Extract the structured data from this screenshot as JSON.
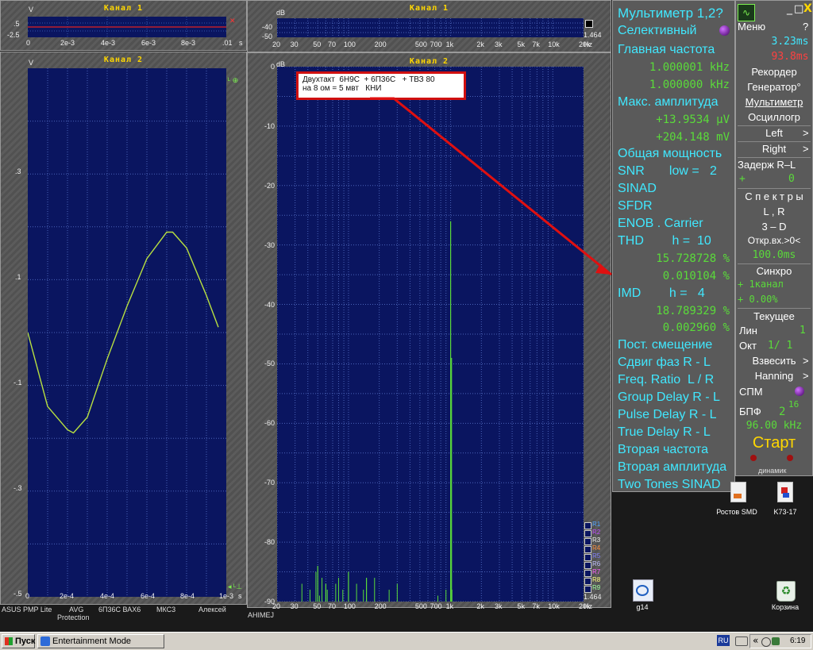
{
  "ch1_small": {
    "title": "Канал 1",
    "y_ticks": [
      ".5",
      "-2.5"
    ],
    "y_unit": "V",
    "x_ticks": [
      "0",
      "2e-3",
      "4e-3",
      "6e-3",
      "8e-3",
      ".01"
    ],
    "x_unit": "s"
  },
  "ch2_scope": {
    "title": "Канал 2",
    "y_unit": "V",
    "y_ticks": [
      ".3",
      ".1",
      "-.1",
      "-.3",
      "-.5"
    ],
    "x_ticks": [
      "0",
      "2e-4",
      "4e-4",
      "6e-4",
      "8e-4",
      "1e-3"
    ],
    "x_unit": "s"
  },
  "spec1": {
    "title": "Канал 1",
    "y_unit": "dB",
    "y_ticks": [
      "-40",
      "-50"
    ],
    "side_value": "1.464",
    "x_ticks": [
      "20",
      "30",
      "50",
      "70",
      "100",
      "200",
      "500",
      "700",
      "1k",
      "2k",
      "3k",
      "5k",
      "7k",
      "10k",
      "20k",
      "Hz"
    ]
  },
  "spec2": {
    "title": "Канал 2",
    "y_unit": "dB",
    "y_ticks": [
      "0",
      "-10",
      "-20",
      "-30",
      "-40",
      "-50",
      "-60",
      "-70",
      "-80",
      "-90"
    ],
    "x_ticks": [
      "20",
      "30",
      "50",
      "70",
      "100",
      "200",
      "500",
      "700",
      "1k",
      "2k",
      "3k",
      "5k",
      "7k",
      "10k",
      "20k",
      "Hz"
    ],
    "side_value": "1.464",
    "legend": [
      "R1",
      "R2",
      "R3",
      "R4",
      "R5",
      "R6",
      "R7",
      "R8",
      "R9"
    ],
    "legend_colors": [
      "#4fa3ff",
      "#c04bff",
      "#f0f0f0",
      "#ff9040",
      "#8080ff",
      "#c0c0ff",
      "#ff60ff",
      "#ffff80",
      "#a0ffa0"
    ]
  },
  "annotation": {
    "line1": "Двухтакт  6Н9С  + 6П36С   + ТВЗ 80",
    "line2": "на 8 ом = 5 мвт   КНИ"
  },
  "multimeter": {
    "title": "Мультиметр 1,2?",
    "mode": "Селективный",
    "rows": [
      {
        "t": "Главная частота",
        "k": "label"
      },
      {
        "t": "1.000001 kHz",
        "k": "value"
      },
      {
        "t": "1.000000 kHz",
        "k": "value"
      },
      {
        "t": "Макс. амплитуда",
        "k": "label"
      },
      {
        "t": "+13.9534 μV",
        "k": "value"
      },
      {
        "t": "+204.148 mV",
        "k": "value"
      },
      {
        "t": "Общая мощность",
        "k": "label"
      },
      {
        "t": "SNR       low =   2",
        "k": "label"
      },
      {
        "t": "SINAD",
        "k": "label"
      },
      {
        "t": "SFDR",
        "k": "label"
      },
      {
        "t": "ENOB . Carrier",
        "k": "label"
      },
      {
        "t": "THD        h =  10",
        "k": "label"
      },
      {
        "t": "15.728728 %",
        "k": "value"
      },
      {
        "t": "0.010104 %",
        "k": "value"
      },
      {
        "t": "IMD        h =   4",
        "k": "label"
      },
      {
        "t": "18.789329 %",
        "k": "value"
      },
      {
        "t": "0.002960 %",
        "k": "value"
      },
      {
        "t": "Пост. смещение",
        "k": "label"
      },
      {
        "t": "Сдвиг фаз R - L",
        "k": "label"
      },
      {
        "t": "Freq. Ratio  L / R",
        "k": "label"
      },
      {
        "t": "Group Delay R - L",
        "k": "label"
      },
      {
        "t": "Pulse Delay R - L",
        "k": "label"
      },
      {
        "t": "True Delay R - L",
        "k": "label"
      },
      {
        "t": "Вторая частота",
        "k": "label"
      },
      {
        "t": "Вторая амплитуда",
        "k": "label"
      },
      {
        "t": "Two Tones SINAD",
        "k": "label"
      }
    ]
  },
  "side": {
    "menu": "Меню",
    "help": "?",
    "min_btn": "_",
    "restore_btn": "□",
    "close_btn": "X",
    "time1": "3.23ms",
    "time2": "93.8ms",
    "recorder": "Рекордер",
    "generator": "Генератор°",
    "multimeter": "Мультиметр",
    "oscillograph": "Осциллогр",
    "left": "Left",
    "right": "Right",
    "arrow": ">",
    "delay": "Задерж  R–L",
    "delay_sign": "+",
    "delay_val": "0",
    "spectra": "С п е к т р ы",
    "lr": "L , R",
    "three_d": "3 – D",
    "open_in": "Откр.вх.>0<",
    "open_val": "100.0ms",
    "sync": "Синхро",
    "sync_ch": "+ 1канал",
    "sync_pct": "+ 0.00%",
    "current": "Текущее",
    "lin": "Лин",
    "lin_val": "1",
    "oct": "Окт",
    "oct_val": "1/ 1",
    "weigh": "Взвесить",
    "hanning": "Hanning",
    "spm": "СПМ",
    "fft": "БПФ",
    "fft_base": "2",
    "fft_exp": "16",
    "rate": "96.00 kHz",
    "start": "Старт"
  },
  "desktop": {
    "left_labels": [
      "ASUS PMP Lite",
      "AVG",
      "6П36С ВАХ6",
      "МКС3",
      "Алексей"
    ],
    "avg_sub": "Protection",
    "spec_below": "AHIMEJ",
    "icons": [
      {
        "label": "Ростов SMD"
      },
      {
        "label": "K73-17"
      },
      {
        "label": "g14"
      },
      {
        "label": "Корзина"
      }
    ],
    "dinamik": "динамик"
  },
  "taskbar": {
    "start": "Пуск",
    "task": "Entertainment Mode",
    "lang": "RU",
    "time": "6:19",
    "tray_arrow": "«"
  },
  "chart_data": [
    {
      "type": "line",
      "title": "Канал 2",
      "xlabel": "s",
      "ylabel": "V",
      "xlim": [
        0,
        0.001
      ],
      "ylim": [
        -0.5,
        0.4
      ],
      "series": [
        {
          "x": [
            0,
            0.0001,
            0.0002,
            0.00023,
            0.0003,
            0.0004,
            0.0005,
            0.0006,
            0.0007,
            0.00073,
            0.0008,
            0.0009,
            0.00096
          ],
          "values": [
            0.0,
            -0.14,
            -0.184,
            -0.19,
            -0.16,
            -0.05,
            0.05,
            0.14,
            0.19,
            0.19,
            0.16,
            0.07,
            0.01
          ]
        }
      ]
    },
    {
      "type": "bar",
      "title": "Канал 2",
      "xlabel": "Hz",
      "ylabel": "dB",
      "ylim": [
        -90,
        0
      ],
      "categories": [
        "50",
        "60",
        "100",
        "150",
        "1000",
        "1020"
      ],
      "values": [
        -84,
        -87,
        -85,
        -86,
        -26,
        -49
      ]
    }
  ]
}
